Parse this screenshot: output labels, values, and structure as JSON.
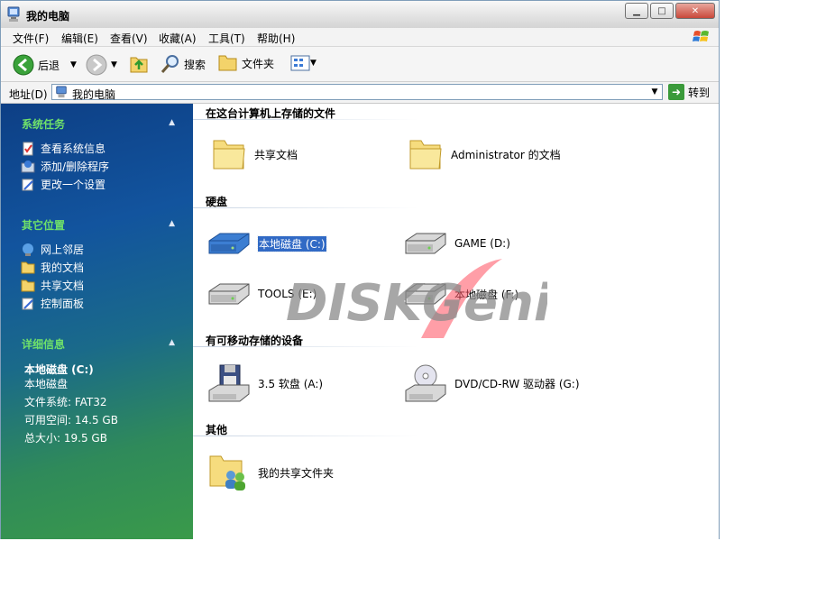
{
  "window": {
    "title": "我的电脑"
  },
  "menu": [
    "文件(F)",
    "编辑(E)",
    "查看(V)",
    "收藏(A)",
    "工具(T)",
    "帮助(H)"
  ],
  "toolbar": {
    "back": "后退",
    "search": "搜索",
    "folders": "文件夹"
  },
  "address": {
    "label": "地址(D)",
    "value": "我的电脑",
    "go": "转到"
  },
  "sidebar": {
    "system_tasks": {
      "title": "系统任务",
      "items": [
        "查看系统信息",
        "添加/删除程序",
        "更改一个设置"
      ]
    },
    "other_places": {
      "title": "其它位置",
      "items": [
        "网上邻居",
        "我的文档",
        "共享文档",
        "控制面板"
      ]
    },
    "details": {
      "title": "详细信息",
      "name": "本地磁盘 (C:)",
      "kind": "本地磁盘",
      "filesystem": "文件系统: FAT32",
      "free": "可用空间: 14.5 GB",
      "total": "总大小: 19.5 GB"
    }
  },
  "groups": {
    "stored": {
      "title": "在这台计算机上存储的文件",
      "items": [
        "共享文档",
        "Administrator 的文档"
      ]
    },
    "hdd": {
      "title": "硬盘",
      "items": [
        "本地磁盘 (C:)",
        "GAME (D:)",
        "TOOLS (E:)",
        "本地磁盘 (F:)"
      ]
    },
    "removable": {
      "title": "有可移动存储的设备",
      "items": [
        "3.5 软盘 (A:)",
        "DVD/CD-RW 驱动器 (G:)"
      ]
    },
    "other": {
      "title": "其他",
      "items": [
        "我的共享文件夹"
      ]
    }
  },
  "watermark": {
    "text": "DISKGenius"
  },
  "colors": {
    "sidebar_heading": "#6fe16a",
    "selection": "#316ac5"
  }
}
